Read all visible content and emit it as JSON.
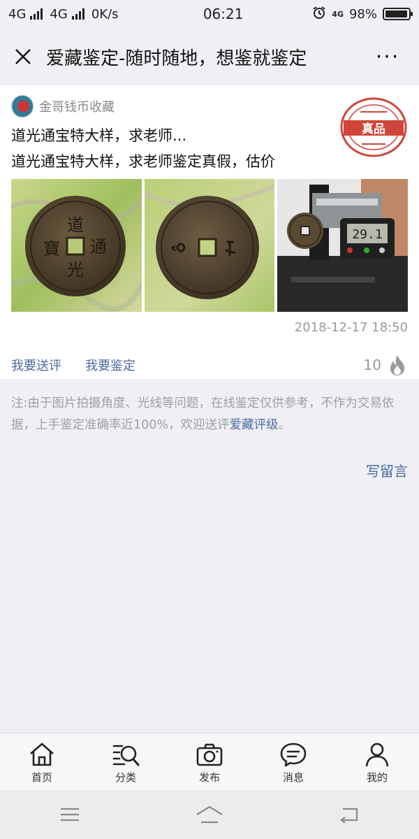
{
  "status_bar": {
    "network1": "4G",
    "network2": "4G",
    "speed": "0K/s",
    "time": "06:21",
    "small_net": "4G",
    "battery": "98%",
    "battery_level": 0.98
  },
  "title_bar": {
    "title": "爱藏鉴定-随时随地，想鉴就鉴定",
    "more": "···"
  },
  "post": {
    "author": "金哥钱币收藏",
    "seal_text": "真品",
    "title": "道光通宝特大样，求老师...",
    "description": "道光通宝特大样，求老师鉴定真假，估价",
    "date": "2018-12-17 18:50",
    "actions": [
      "我要送评",
      "我要鉴定"
    ],
    "hot_count": "10",
    "images": [
      "coin-front-photo",
      "coin-back-photo",
      "coin-caliper-photo"
    ],
    "caliper_reading": "29.1"
  },
  "notice": {
    "text": "注:由于图片拍摄角度、光线等问题，在线鉴定仅供参考，不作为交易依据，上手鉴定准确率近100%，欢迎送评",
    "link": "爱藏评级",
    "end": "。"
  },
  "comment_button": "写留言",
  "tabs": [
    {
      "label": "首页",
      "icon": "home-icon"
    },
    {
      "label": "分类",
      "icon": "category-search-icon"
    },
    {
      "label": "发布",
      "icon": "camera-icon"
    },
    {
      "label": "消息",
      "icon": "message-icon"
    },
    {
      "label": "我的",
      "icon": "user-icon"
    }
  ],
  "colors": {
    "link": "#4a6aa0",
    "seal": "#d0453a",
    "background": "#efeff4"
  }
}
